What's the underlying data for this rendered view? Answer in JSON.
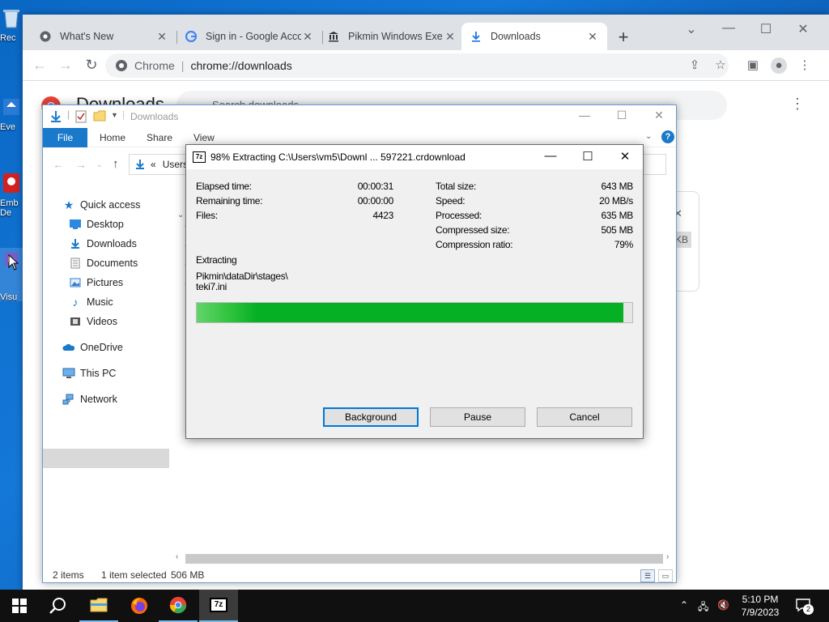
{
  "desktop": {
    "icons": [
      {
        "label": "Rec"
      },
      {
        "label": "Eve"
      },
      {
        "label": "Emb De"
      },
      {
        "label": "Visu"
      }
    ]
  },
  "chrome": {
    "tabs": [
      {
        "title": "What's New",
        "icon": "chrome-icon"
      },
      {
        "title": "Sign in - Google Acco",
        "icon": "google-icon"
      },
      {
        "title": "Pikmin Windows Exe",
        "icon": "museum-icon"
      },
      {
        "title": "Downloads",
        "icon": "download-icon"
      }
    ],
    "omnibox": {
      "site_label": "Chrome",
      "url": "chrome://downloads"
    },
    "page": {
      "title": "Downloads",
      "search_placeholder": "Search downloads",
      "card_size_fragment": "0 KB"
    }
  },
  "explorer": {
    "title": "Downloads",
    "ribbon": {
      "file": "File",
      "home": "Home",
      "share": "Share",
      "view": "View",
      "help": "?"
    },
    "address": {
      "chevron": "«",
      "path": "Users"
    },
    "nav": {
      "quick_access": "Quick access",
      "desktop": "Desktop",
      "downloads": "Downloads",
      "documents": "Documents",
      "pictures": "Pictures",
      "music": "Music",
      "videos": "Videos",
      "onedrive": "OneDrive",
      "this_pc": "This PC",
      "network": "Network"
    },
    "status": {
      "items": "2 items",
      "selected": "1 item selected",
      "size": "506 MB"
    }
  },
  "zip": {
    "title": "98% Extracting C:\\Users\\vm5\\Downl ... 597221.crdownload",
    "progress_percent": 98,
    "labels": {
      "elapsed": "Elapsed time:",
      "remaining": "Remaining time:",
      "files": "Files:",
      "total_size": "Total size:",
      "speed": "Speed:",
      "processed": "Processed:",
      "compressed_size": "Compressed size:",
      "ratio": "Compression ratio:",
      "extracting": "Extracting"
    },
    "values": {
      "elapsed": "00:00:31",
      "remaining": "00:00:00",
      "files": "4423",
      "total_size": "643 MB",
      "speed": "20 MB/s",
      "processed": "635 MB",
      "compressed_size": "505 MB",
      "ratio": "79%"
    },
    "current_path_line1": "Pikmin\\dataDir\\stages\\",
    "current_path_line2": "teki7.ini",
    "buttons": {
      "background": "Background",
      "pause": "Pause",
      "cancel": "Cancel"
    }
  },
  "taskbar": {
    "clock_time": "5:10 PM",
    "clock_date": "7/9/2023",
    "notification_count": "2",
    "zip_label": "7z"
  },
  "colors": {
    "progress_green": "#06b025",
    "explorer_accent": "#1979ca",
    "desktop_blue": "#0a67c4"
  }
}
